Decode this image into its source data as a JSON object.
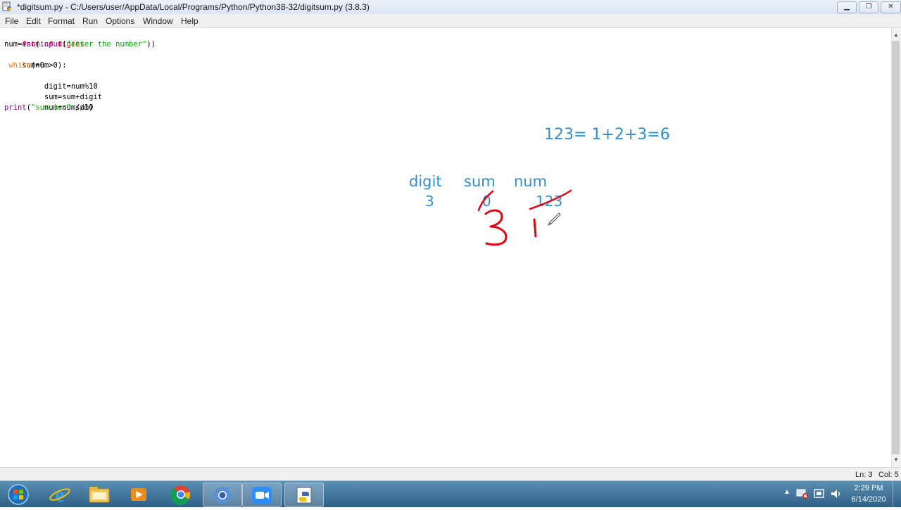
{
  "window": {
    "title": "*digitsum.py - C:/Users/user/AppData/Local/Programs/Python/Python38-32/digitsum.py (3.8.3)",
    "minimize_icon": "minimize-icon",
    "maximize_icon": "maximize-icon",
    "close_icon": "close-icon"
  },
  "menu": [
    "File",
    "Edit",
    "Format",
    "Run",
    "Options",
    "Window",
    "Help"
  ],
  "code": {
    "line1": "#sum of digits",
    "line2_a": "num=",
    "line2_b": "int",
    "line2_c": "(",
    "line2_d": "input",
    "line2_e": "(",
    "line2_f": "\"enter the number\"",
    "line2_g": "))",
    "line3": "sum=0",
    "line4_indent": " ",
    "line4_kw": "while",
    "line4_rest": "(num>0):",
    "line5": "     digit=num%10",
    "line6": "     sum=sum+digit",
    "line7": "     num=num//10",
    "line8_a": "print",
    "line8_b": "(",
    "line8_c": "\"sum is:\"",
    "line8_d": " sum)"
  },
  "annotations": {
    "equation": "123= 1+2+3=6",
    "col_digit": "digit",
    "col_sum": "sum",
    "col_num": "num",
    "val_digit": "3",
    "val_sum": "0",
    "val_num": "123",
    "pen_color": "#e8000f",
    "text_color": "#2f8fd6"
  },
  "status": {
    "line": "Ln: 3",
    "col": "Col: 5"
  },
  "taskbar": {
    "apps": [
      "start-orb-icon",
      "internet-explorer-icon",
      "file-explorer-icon",
      "media-player-icon",
      "chrome-icon",
      "chrome-alt-icon",
      "zoom-icon",
      "python-idle-icon"
    ],
    "time": "2:29 PM",
    "date": "6/14/2020"
  }
}
